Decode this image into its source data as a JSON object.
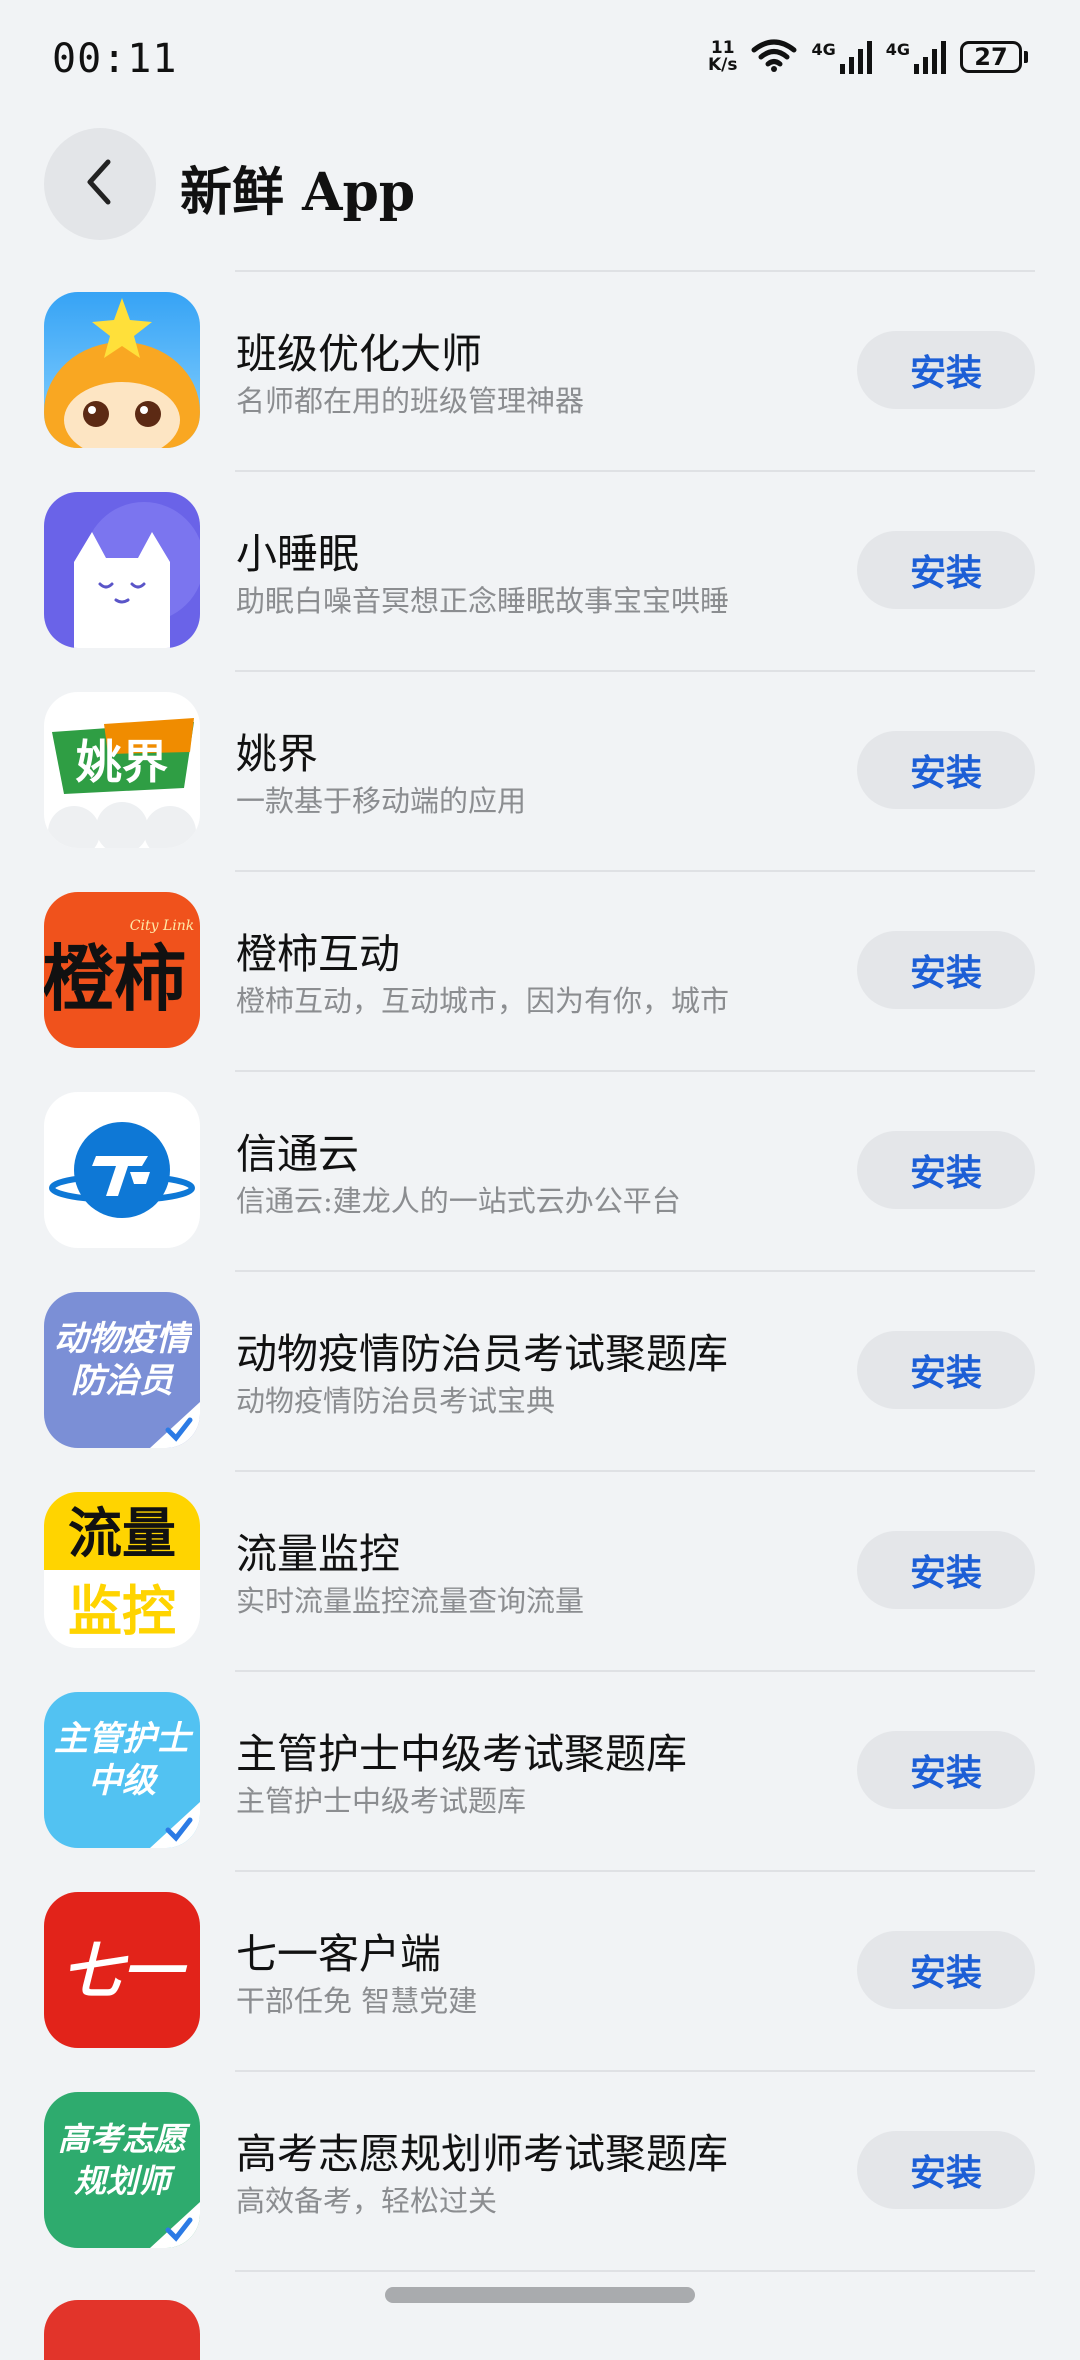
{
  "status_bar": {
    "time": "00:11",
    "net_speed_value": "11",
    "net_speed_unit": "K/s",
    "signal1_tag": "4G",
    "signal2_tag": "4G",
    "battery": "27"
  },
  "header": {
    "title": "新鲜 App"
  },
  "apps": [
    {
      "name": "班级优化大师",
      "desc": "名师都在用的班级管理神器",
      "button": "安装",
      "icon": "monkey-mascot-icon"
    },
    {
      "name": "小睡眠",
      "desc": "助眠白噪音冥想正念睡眠故事宝宝哄睡",
      "button": "安装",
      "icon": "sleeping-cat-icon"
    },
    {
      "name": "姚界",
      "desc": "一款基于移动端的应用",
      "button": "安装",
      "icon": "yaojie-logo-icon",
      "icon_text": "姚界"
    },
    {
      "name": "橙柿互动",
      "desc": "橙柿互动，互动城市，因为有你，城市",
      "button": "安装",
      "icon": "chengshi-logo-icon",
      "icon_text": "橙柿",
      "icon_subtext": "City Link"
    },
    {
      "name": "信通云",
      "desc": "信通云:建龙人的一站式云办公平台",
      "button": "安装",
      "icon": "xintongyun-logo-icon"
    },
    {
      "name": "动物疫情防治员考试聚题库",
      "desc": "动物疫情防治员考试宝典",
      "button": "安装",
      "icon": "exam-book-icon",
      "icon_text": "动物疫情防治员"
    },
    {
      "name": "流量监控",
      "desc": "实时流量监控流量查询流量",
      "button": "安装",
      "icon": "traffic-monitor-icon",
      "icon_text_top": "流量",
      "icon_text_bottom": "监控"
    },
    {
      "name": "主管护士中级考试聚题库",
      "desc": "主管护士中级考试题库",
      "button": "安装",
      "icon": "nurse-exam-icon",
      "icon_text": "主管护士中级"
    },
    {
      "name": "七一客户端",
      "desc": "干部任免 智慧党建",
      "button": "安装",
      "icon": "qiyi-logo-icon",
      "icon_text": "七一"
    },
    {
      "name": "高考志愿规划师考试聚题库",
      "desc": "高效备考，轻松过关",
      "button": "安装",
      "icon": "gaokao-exam-icon",
      "icon_text": "高考志愿规划师"
    }
  ]
}
